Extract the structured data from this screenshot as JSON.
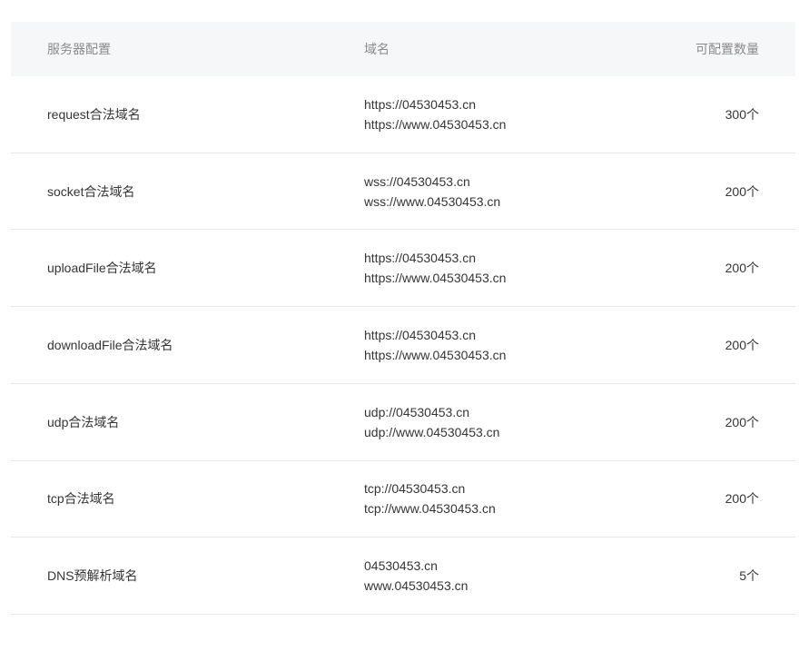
{
  "table": {
    "headers": {
      "config": "服务器配置",
      "domain": "域名",
      "count": "可配置数量"
    },
    "rows": [
      {
        "config": "request合法域名",
        "domains": [
          "https://04530453.cn",
          "https://www.04530453.cn"
        ],
        "count": "300个"
      },
      {
        "config": "socket合法域名",
        "domains": [
          "wss://04530453.cn",
          "wss://www.04530453.cn"
        ],
        "count": "200个"
      },
      {
        "config": "uploadFile合法域名",
        "domains": [
          "https://04530453.cn",
          "https://www.04530453.cn"
        ],
        "count": "200个"
      },
      {
        "config": "downloadFile合法域名",
        "domains": [
          "https://04530453.cn",
          "https://www.04530453.cn"
        ],
        "count": "200个"
      },
      {
        "config": "udp合法域名",
        "domains": [
          "udp://04530453.cn",
          "udp://www.04530453.cn"
        ],
        "count": "200个"
      },
      {
        "config": "tcp合法域名",
        "domains": [
          "tcp://04530453.cn",
          "tcp://www.04530453.cn"
        ],
        "count": "200个"
      },
      {
        "config": "DNS预解析域名",
        "domains": [
          "04530453.cn",
          "www.04530453.cn"
        ],
        "count": "5个"
      }
    ],
    "colors": {
      "header_bg": "#f6f7f9",
      "header_text": "#8a8a8a",
      "body_text": "#353535",
      "border": "#e7e7eb"
    }
  }
}
